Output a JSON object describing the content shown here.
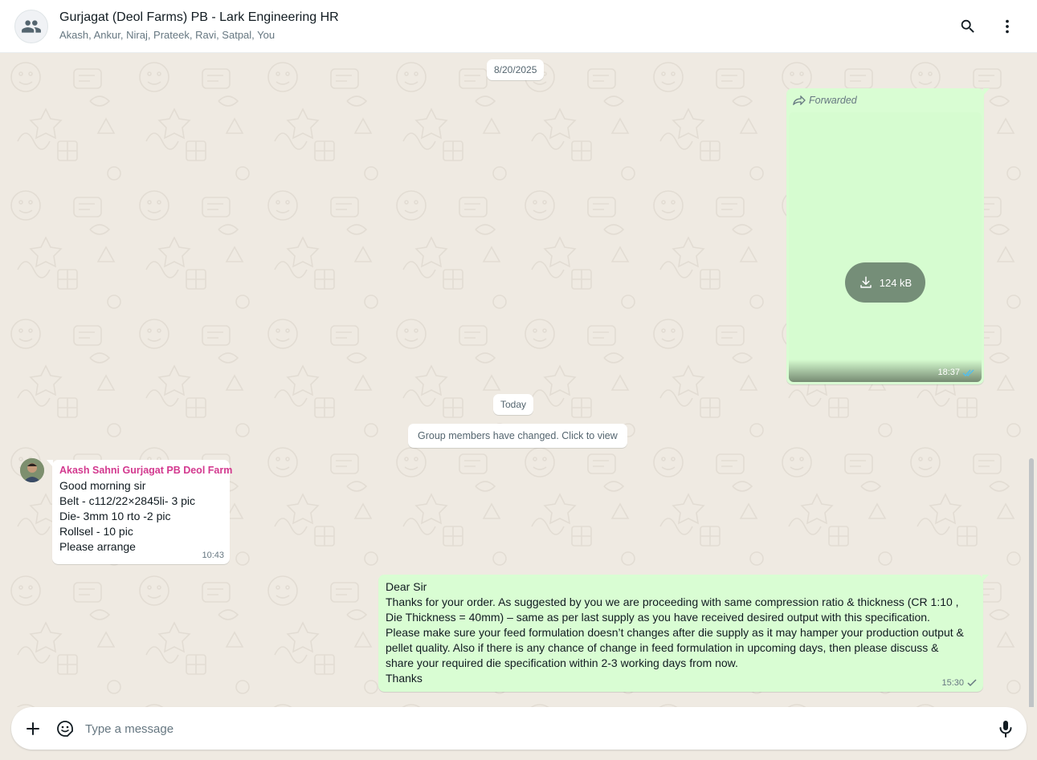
{
  "header": {
    "title": "Gurjagat (Deol Farms) PB - Lark Engineering HR",
    "members": "Akash, Ankur, Niraj, Prateek, Ravi, Satpal, You",
    "icons": [
      "group-avatar-icon",
      "search-icon",
      "more-vertical-icon"
    ]
  },
  "chat": {
    "date_pill_1": "8/20/2025",
    "doc_message": {
      "forwarded_label": "Forwarded",
      "file_size": "124 kB",
      "time": "18:37",
      "status": "read"
    },
    "date_pill_2": "Today",
    "system_notice": "Group members have changed. Click to view",
    "incoming_message": {
      "sender": "Akash Sahni Gurjagat PB Deol Farm",
      "lines": [
        "Good morning sir",
        "Belt - c112/22×2845li- 3 pic",
        "Die- 3mm 10 rto -2 pic",
        "Rollsel - 10 pic",
        "Please arrange"
      ],
      "time": "10:43"
    },
    "outgoing_message": {
      "lines": [
        "Dear Sir",
        "Thanks for your order. As suggested by you we are proceeding with same compression ratio & thickness (CR 1:10 ,",
        "Die Thickness = 40mm) – same as per last supply as you have received desired output with this specification.",
        "Please make sure your feed formulation doesn’t changes after die supply as it may hamper your production output &",
        "pellet quality. Also if there is any chance of change in feed formulation in upcoming days, then please discuss &",
        "share your required die specification within 2-3 working days from now.",
        "Thanks"
      ],
      "time": "15:30",
      "status": "sent"
    }
  },
  "composer": {
    "placeholder": "Type a message",
    "icons": [
      "plus-icon",
      "sticker-icon",
      "microphone-icon"
    ]
  },
  "colors": {
    "outgoing_bubble": "#d9fdd3",
    "incoming_bubble": "#ffffff",
    "sender_name": "#d3398f",
    "read_tick": "#53bdeb",
    "chat_background": "#efeae2"
  }
}
